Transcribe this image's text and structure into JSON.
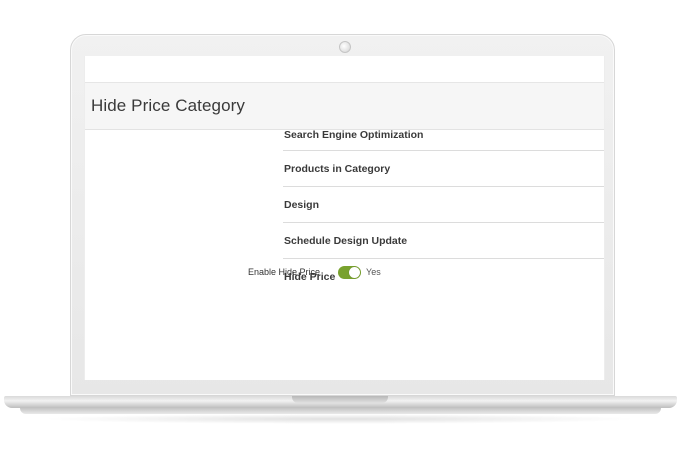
{
  "page": {
    "title": "Hide Price Category"
  },
  "sections": [
    {
      "label": "Search Engine Optimization"
    },
    {
      "label": "Products in Category"
    },
    {
      "label": "Design"
    },
    {
      "label": "Schedule Design Update"
    },
    {
      "label": "Hide Price"
    }
  ],
  "setting": {
    "label": "Enable Hide Price",
    "value_text": "Yes",
    "enabled": true
  },
  "colors": {
    "toggle_on": "#79a22e"
  }
}
